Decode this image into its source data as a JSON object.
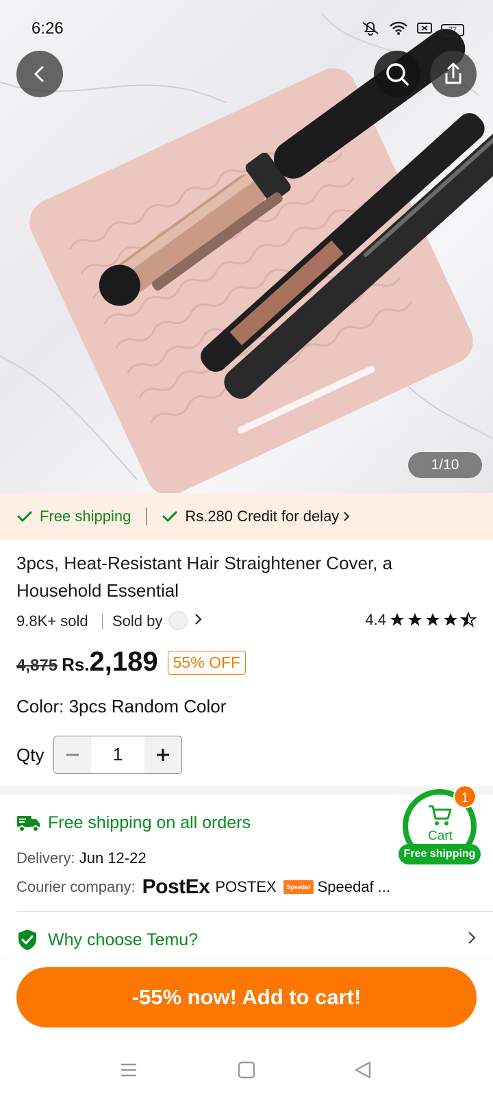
{
  "status_bar": {
    "time": "6:26",
    "battery": "77"
  },
  "hero": {
    "image_counter": "1/10"
  },
  "shipping_strip": {
    "free_shipping": "Free shipping",
    "credit_for_delay": "Rs.280 Credit for delay"
  },
  "product": {
    "title": "3pcs, Heat-Resistant Hair Straightener Cover, a Household Essential",
    "sold": "9.8K+ sold",
    "sold_by": "Sold by",
    "rating": "4.4",
    "old_price": "4,875",
    "currency": "Rs.",
    "price": "2,189",
    "discount": "55% OFF",
    "color_label": "Color: 3pcs Random Color",
    "qty_label": "Qty",
    "qty_value": "1"
  },
  "shipping_info": {
    "headline": "Free shipping on all orders",
    "delivery_label": "Delivery:",
    "delivery_value": "Jun 12-22",
    "courier_label": "Courier company:",
    "courier_logo_1": "PostEx",
    "courier_name_1": "POSTEX",
    "courier_logo_2": "Speedaf",
    "courier_name_2": "Speedaf ..."
  },
  "cart_widget": {
    "label": "Cart",
    "badge": "1",
    "free_shipping": "Free shipping"
  },
  "why_choose": {
    "label": "Why choose Temu?"
  },
  "cta": {
    "add_to_cart": "-55% now! Add to cart!"
  },
  "colors": {
    "accent_orange": "#fb7701",
    "green": "#0a8a1f",
    "strip_bg": "#fdefe3"
  }
}
